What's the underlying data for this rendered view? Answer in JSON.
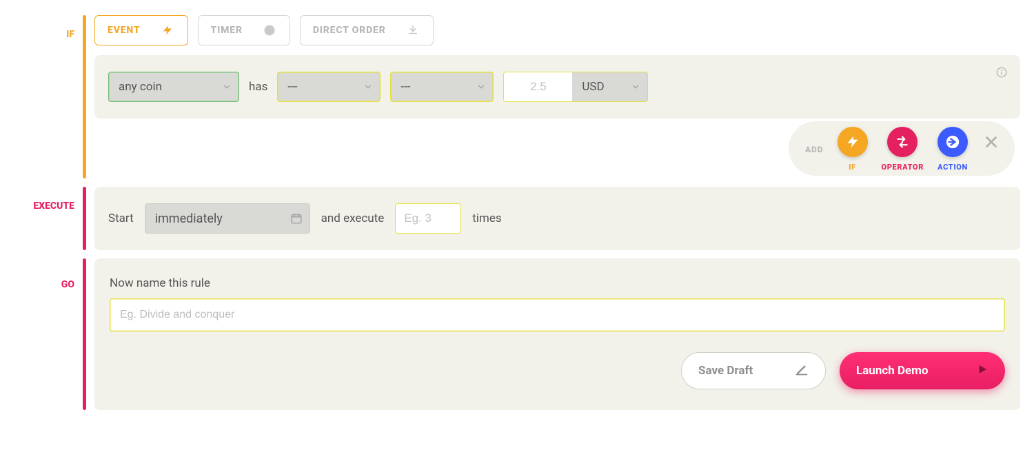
{
  "if": {
    "label": "IF",
    "tabs": {
      "event": {
        "label": "EVENT",
        "selected": true
      },
      "timer": {
        "label": "TIMER",
        "selected": false
      },
      "direct": {
        "label": "DIRECT ORDER",
        "selected": false
      }
    },
    "condition": {
      "coin_value": "any coin",
      "has_label": "has",
      "select1_value": "---",
      "select2_value": "---",
      "number_placeholder": "2.5",
      "number_value": "",
      "unit_value": "USD"
    }
  },
  "add": {
    "label": "ADD",
    "if_caption": "IF",
    "operator_caption": "OPERATOR",
    "action_caption": "ACTION"
  },
  "execute": {
    "label": "EXECUTE",
    "start_label": "Start",
    "start_value": "immediately",
    "and_execute_label": "and execute",
    "times_placeholder": "Eg. 3",
    "times_value": "",
    "times_label": "times"
  },
  "go": {
    "label": "GO",
    "name_title": "Now name this rule",
    "name_placeholder": "Eg. Divide and conquer",
    "name_value": "",
    "save_draft": "Save Draft",
    "launch": "Launch Demo"
  }
}
